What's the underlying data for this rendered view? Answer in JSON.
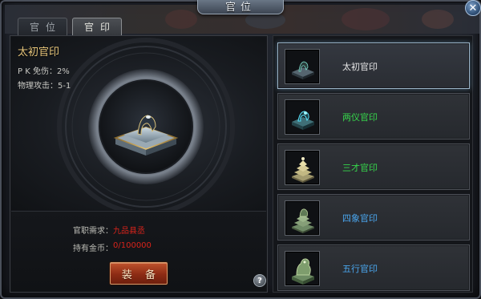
{
  "window": {
    "title": "官位",
    "close_symbol": "✕"
  },
  "tabs": [
    {
      "label": "官位",
      "active": false
    },
    {
      "label": "官印",
      "active": true
    }
  ],
  "detail": {
    "item_name": "太初官印",
    "stats": [
      "P K 免伤：2%",
      "物理攻击：5-1"
    ],
    "requirement_label": "官职需求：",
    "requirement_value": "九品县丞",
    "gold_label": "持有金币：",
    "gold_value": "0/100000",
    "equip_label": "装 备",
    "help_symbol": "?"
  },
  "seals": [
    {
      "name": "太初官印",
      "color": "#e6e6e6",
      "selected": true,
      "icon": "jade-seal-dark-icon"
    },
    {
      "name": "两仪官印",
      "color": "#36d54b",
      "selected": false,
      "icon": "jade-seal-cyan-icon"
    },
    {
      "name": "三才官印",
      "color": "#36d54b",
      "selected": false,
      "icon": "pyramid-seal-tan-icon"
    },
    {
      "name": "四象官印",
      "color": "#4aa6ee",
      "selected": false,
      "icon": "pyramid-seal-green-icon"
    },
    {
      "name": "五行官印",
      "color": "#4aa6ee",
      "selected": false,
      "icon": "beast-seal-green-icon"
    }
  ],
  "colors": {
    "item_name": "#e8c77c",
    "requirement_value": "#d8231b",
    "accent_selected_border": "#9db6c9"
  }
}
